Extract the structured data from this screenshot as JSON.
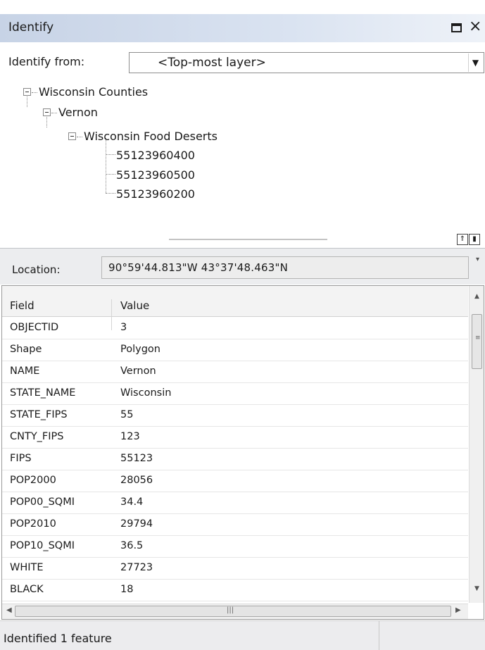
{
  "window": {
    "title": "Identify",
    "maximize_icon": "maximize-icon",
    "close_glyph": "×"
  },
  "identify_from": {
    "label": "Identify from:",
    "value": "<Top-most layer>",
    "dropdown_glyph": "▼"
  },
  "tree": {
    "root": "Wisconsin Counties",
    "county": "Vernon",
    "layer": "Wisconsin Food Deserts",
    "features": [
      "55123960400",
      "55123960500",
      "55123960200"
    ]
  },
  "splitter": {
    "icons": [
      "pin-icon",
      "layout-icon"
    ]
  },
  "location": {
    "label": "Location:",
    "value": "90°59'44.813\"W  43°37'48.463\"N"
  },
  "table": {
    "columns": [
      "Field",
      "Value"
    ],
    "rows": [
      {
        "field": "OBJECTID",
        "value": "3"
      },
      {
        "field": "Shape",
        "value": "Polygon"
      },
      {
        "field": "NAME",
        "value": "Vernon"
      },
      {
        "field": "STATE_NAME",
        "value": "Wisconsin"
      },
      {
        "field": "STATE_FIPS",
        "value": "55"
      },
      {
        "field": "CNTY_FIPS",
        "value": "123"
      },
      {
        "field": "FIPS",
        "value": "55123"
      },
      {
        "field": "POP2000",
        "value": "28056"
      },
      {
        "field": "POP00_SQMI",
        "value": "34.4"
      },
      {
        "field": "POP2010",
        "value": "29794"
      },
      {
        "field": "POP10_SQMI",
        "value": "36.5"
      },
      {
        "field": "WHITE",
        "value": "27723"
      },
      {
        "field": "BLACK",
        "value": "18"
      }
    ]
  },
  "status": {
    "text": "Identified 1 feature"
  }
}
